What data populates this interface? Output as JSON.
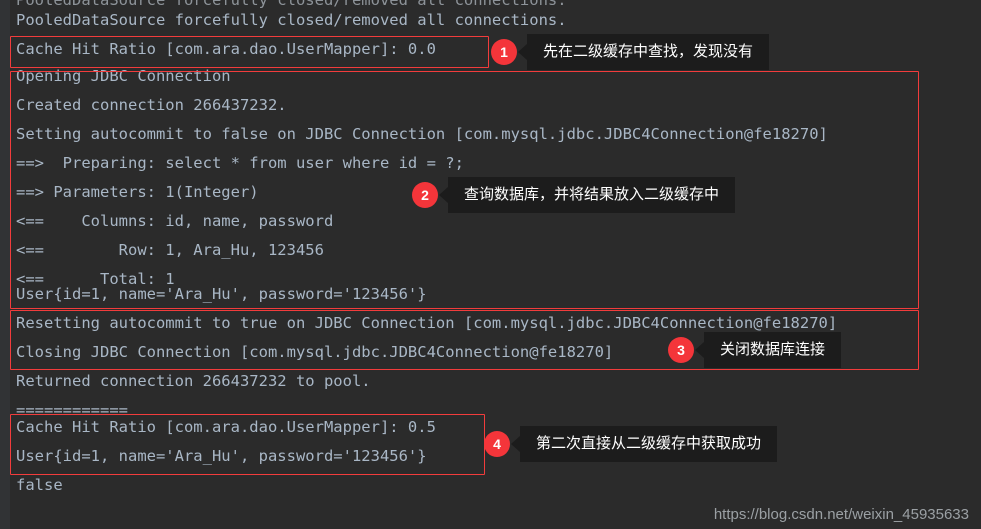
{
  "console": {
    "background_color": "#2b2b2b",
    "text_color": "#a9b7c6",
    "highlight_color": "#f23c3c",
    "lines": [
      {
        "text": "PooledDataSource forcefully closed/removed all connections."
      },
      {
        "text": "PooledDataSource forcefully closed/removed all connections."
      },
      {
        "text": "Cache Hit Ratio [com.ara.dao.UserMapper]: 0.0"
      },
      {
        "text": "Opening JDBC Connection"
      },
      {
        "text": "Created connection 266437232."
      },
      {
        "text": "Setting autocommit to false on JDBC Connection [com.mysql.jdbc.JDBC4Connection@fe18270]"
      },
      {
        "text": "==>  Preparing: select * from user where id = ?;"
      },
      {
        "text": "==> Parameters: 1(Integer)"
      },
      {
        "text": "<==    Columns: id, name, password"
      },
      {
        "text": "<==        Row: 1, Ara_Hu, 123456"
      },
      {
        "text": "<==      Total: 1"
      },
      {
        "text": "User{id=1, name='Ara_Hu', password='123456'}"
      },
      {
        "text": "Resetting autocommit to true on JDBC Connection [com.mysql.jdbc.JDBC4Connection@fe18270]"
      },
      {
        "text": "Closing JDBC Connection [com.mysql.jdbc.JDBC4Connection@fe18270]"
      },
      {
        "text": "Returned connection 266437232 to pool."
      },
      {
        "text": "============"
      },
      {
        "text": "Cache Hit Ratio [com.ara.dao.UserMapper]: 0.5"
      },
      {
        "text": "User{id=1, name='Ara_Hu', password='123456'}"
      },
      {
        "text": "false"
      }
    ]
  },
  "annotations": [
    {
      "number": "1",
      "text": "先在二级缓存中查找，发现没有"
    },
    {
      "number": "2",
      "text": "查询数据库，并将结果放入二级缓存中"
    },
    {
      "number": "3",
      "text": "关闭数据库连接"
    },
    {
      "number": "4",
      "text": "第二次直接从二级缓存中获取成功"
    }
  ],
  "watermark": {
    "text": "https://blog.csdn.net/weixin_45935633"
  }
}
